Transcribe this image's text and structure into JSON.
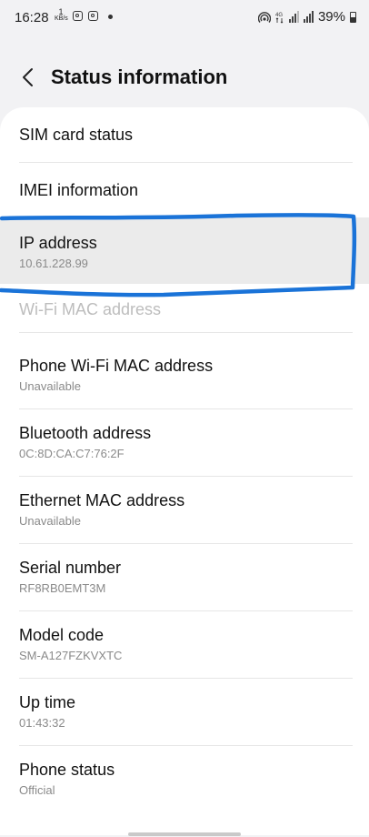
{
  "status_bar": {
    "time": "16:28",
    "net_speed_value": "1",
    "net_speed_unit": "KB/s",
    "battery": "39%",
    "icons": [
      "instagram-icon",
      "instagram-icon",
      "notification-dot-icon",
      "hotspot-icon",
      "4g-icon",
      "signal-icon",
      "signal-icon",
      "battery-icon"
    ]
  },
  "header": {
    "title": "Status information",
    "back_icon": "chevron-left-icon"
  },
  "items": [
    {
      "label": "SIM card status"
    },
    {
      "label": "IMEI information"
    },
    {
      "label": "IP address",
      "value": "10.61.228.99"
    },
    {
      "label": "Wi-Fi MAC address"
    },
    {
      "label": "Phone Wi-Fi MAC address",
      "value": "Unavailable"
    },
    {
      "label": "Bluetooth address",
      "value": "0C:8D:CA:C7:76:2F"
    },
    {
      "label": "Ethernet MAC address",
      "value": "Unavailable"
    },
    {
      "label": "Serial number",
      "value": "RF8RB0EMT3M"
    },
    {
      "label": "Model code",
      "value": "SM-A127FZKVXTC"
    },
    {
      "label": "Up time",
      "value": "01:43:32"
    },
    {
      "label": "Phone status",
      "value": "Official"
    }
  ],
  "colors": {
    "annotation": "#1a73d8",
    "background": "#f2f2f4",
    "card": "#ffffff",
    "highlight": "#ebebeb"
  }
}
